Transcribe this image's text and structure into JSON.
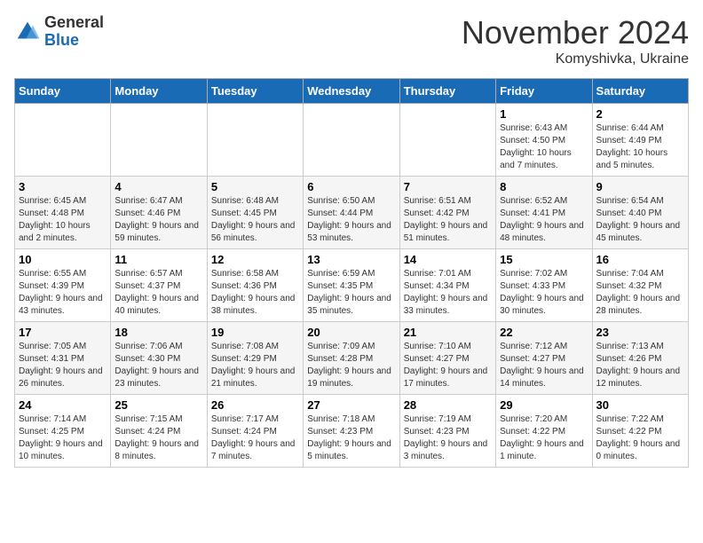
{
  "header": {
    "logo_general": "General",
    "logo_blue": "Blue",
    "month_title": "November 2024",
    "location": "Komyshivka, Ukraine"
  },
  "days_of_week": [
    "Sunday",
    "Monday",
    "Tuesday",
    "Wednesday",
    "Thursday",
    "Friday",
    "Saturday"
  ],
  "weeks": [
    [
      {
        "day": "",
        "info": ""
      },
      {
        "day": "",
        "info": ""
      },
      {
        "day": "",
        "info": ""
      },
      {
        "day": "",
        "info": ""
      },
      {
        "day": "",
        "info": ""
      },
      {
        "day": "1",
        "info": "Sunrise: 6:43 AM\nSunset: 4:50 PM\nDaylight: 10 hours and 7 minutes."
      },
      {
        "day": "2",
        "info": "Sunrise: 6:44 AM\nSunset: 4:49 PM\nDaylight: 10 hours and 5 minutes."
      }
    ],
    [
      {
        "day": "3",
        "info": "Sunrise: 6:45 AM\nSunset: 4:48 PM\nDaylight: 10 hours and 2 minutes."
      },
      {
        "day": "4",
        "info": "Sunrise: 6:47 AM\nSunset: 4:46 PM\nDaylight: 9 hours and 59 minutes."
      },
      {
        "day": "5",
        "info": "Sunrise: 6:48 AM\nSunset: 4:45 PM\nDaylight: 9 hours and 56 minutes."
      },
      {
        "day": "6",
        "info": "Sunrise: 6:50 AM\nSunset: 4:44 PM\nDaylight: 9 hours and 53 minutes."
      },
      {
        "day": "7",
        "info": "Sunrise: 6:51 AM\nSunset: 4:42 PM\nDaylight: 9 hours and 51 minutes."
      },
      {
        "day": "8",
        "info": "Sunrise: 6:52 AM\nSunset: 4:41 PM\nDaylight: 9 hours and 48 minutes."
      },
      {
        "day": "9",
        "info": "Sunrise: 6:54 AM\nSunset: 4:40 PM\nDaylight: 9 hours and 45 minutes."
      }
    ],
    [
      {
        "day": "10",
        "info": "Sunrise: 6:55 AM\nSunset: 4:39 PM\nDaylight: 9 hours and 43 minutes."
      },
      {
        "day": "11",
        "info": "Sunrise: 6:57 AM\nSunset: 4:37 PM\nDaylight: 9 hours and 40 minutes."
      },
      {
        "day": "12",
        "info": "Sunrise: 6:58 AM\nSunset: 4:36 PM\nDaylight: 9 hours and 38 minutes."
      },
      {
        "day": "13",
        "info": "Sunrise: 6:59 AM\nSunset: 4:35 PM\nDaylight: 9 hours and 35 minutes."
      },
      {
        "day": "14",
        "info": "Sunrise: 7:01 AM\nSunset: 4:34 PM\nDaylight: 9 hours and 33 minutes."
      },
      {
        "day": "15",
        "info": "Sunrise: 7:02 AM\nSunset: 4:33 PM\nDaylight: 9 hours and 30 minutes."
      },
      {
        "day": "16",
        "info": "Sunrise: 7:04 AM\nSunset: 4:32 PM\nDaylight: 9 hours and 28 minutes."
      }
    ],
    [
      {
        "day": "17",
        "info": "Sunrise: 7:05 AM\nSunset: 4:31 PM\nDaylight: 9 hours and 26 minutes."
      },
      {
        "day": "18",
        "info": "Sunrise: 7:06 AM\nSunset: 4:30 PM\nDaylight: 9 hours and 23 minutes."
      },
      {
        "day": "19",
        "info": "Sunrise: 7:08 AM\nSunset: 4:29 PM\nDaylight: 9 hours and 21 minutes."
      },
      {
        "day": "20",
        "info": "Sunrise: 7:09 AM\nSunset: 4:28 PM\nDaylight: 9 hours and 19 minutes."
      },
      {
        "day": "21",
        "info": "Sunrise: 7:10 AM\nSunset: 4:27 PM\nDaylight: 9 hours and 17 minutes."
      },
      {
        "day": "22",
        "info": "Sunrise: 7:12 AM\nSunset: 4:27 PM\nDaylight: 9 hours and 14 minutes."
      },
      {
        "day": "23",
        "info": "Sunrise: 7:13 AM\nSunset: 4:26 PM\nDaylight: 9 hours and 12 minutes."
      }
    ],
    [
      {
        "day": "24",
        "info": "Sunrise: 7:14 AM\nSunset: 4:25 PM\nDaylight: 9 hours and 10 minutes."
      },
      {
        "day": "25",
        "info": "Sunrise: 7:15 AM\nSunset: 4:24 PM\nDaylight: 9 hours and 8 minutes."
      },
      {
        "day": "26",
        "info": "Sunrise: 7:17 AM\nSunset: 4:24 PM\nDaylight: 9 hours and 7 minutes."
      },
      {
        "day": "27",
        "info": "Sunrise: 7:18 AM\nSunset: 4:23 PM\nDaylight: 9 hours and 5 minutes."
      },
      {
        "day": "28",
        "info": "Sunrise: 7:19 AM\nSunset: 4:23 PM\nDaylight: 9 hours and 3 minutes."
      },
      {
        "day": "29",
        "info": "Sunrise: 7:20 AM\nSunset: 4:22 PM\nDaylight: 9 hours and 1 minute."
      },
      {
        "day": "30",
        "info": "Sunrise: 7:22 AM\nSunset: 4:22 PM\nDaylight: 9 hours and 0 minutes."
      }
    ]
  ]
}
